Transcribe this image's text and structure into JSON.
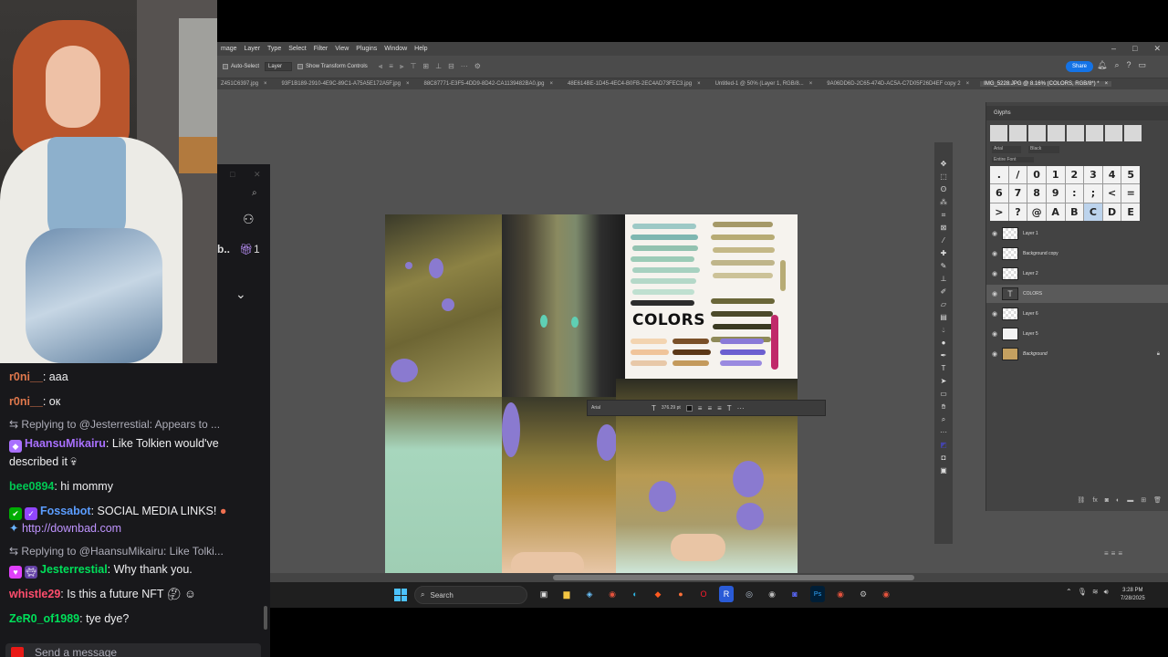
{
  "photoshop": {
    "menu": [
      "mage",
      "Layer",
      "Type",
      "Select",
      "Filter",
      "View",
      "Plugins",
      "Window",
      "Help"
    ],
    "options": {
      "auto_select_label": "Auto-Select",
      "auto_select_value": "Layer",
      "transform_label": "Show Transform Controls",
      "share_label": "Share"
    },
    "doc_tabs": [
      "Z451C6397.jpg",
      "93F1B189-2910-4E9C-89C1-A75A5E172A5F.jpg",
      "88C87771-E3F5-4DD9-8D42-CA1139482BA0.jpg",
      "48E614BE-1D45-4EC4-B0FB-2EC4AD73FEC3.jpg",
      "Untitled-1 @ 50% (Layer 1, RGB/8...",
      "9A06DD6D-2C65-474D-AC5A-C7D05F26D4EF copy 2",
      "IMG_5228.JPG @ 8.16% (COLORS, RGB/8*) *"
    ],
    "canvas_text": "COLORS",
    "text_bar": {
      "font": "Arial",
      "size": "376.29 pt"
    },
    "glyphs": {
      "title": "Glyphs",
      "font": "Arial",
      "style": "Black",
      "scope": "Entire Font",
      "chars": [
        ".",
        "/",
        "0",
        "1",
        "2",
        "3",
        "4",
        "5",
        "6",
        "7",
        "8",
        "9",
        ":",
        ";",
        "<",
        "=",
        ">",
        "?",
        "@",
        "A",
        "B",
        "C",
        "D",
        "E"
      ]
    },
    "layers": [
      "Layer 1",
      "Background copy",
      "Layer 2",
      "COLORS",
      "Layer 6",
      "Layer 5",
      "Background"
    ]
  },
  "taskbar": {
    "search_label": "Search",
    "time": "3:28 PM",
    "date": "7/28/2025"
  },
  "chat": {
    "messages": [
      {
        "user": "r0ni__",
        "color": "#e0784c",
        "text": ": aaa"
      },
      {
        "user": "r0ni__",
        "color": "#e0784c",
        "text": ": ок"
      },
      {
        "reply": "Replying to @Jesterrestial: Appears to ..."
      },
      {
        "user": "HaansuMikairu",
        "color": "#a970ff",
        "text": ": Like Tolkien would've described it"
      },
      {
        "user": "bee0894",
        "color": "#00c853",
        "text": ": hi mommy"
      },
      {
        "user": "Fossabot",
        "color": "#5b9dff",
        "text": ": SOCIAL MEDIA LINKS!"
      },
      {
        "link": "http://downbad.com"
      },
      {
        "reply": "Replying to @HaansuMikairu: Like Tolki..."
      },
      {
        "user": "Jesterrestial",
        "color": "#00e05a",
        "text": ": Why thank you."
      },
      {
        "user": "whistle29",
        "color": "#ff4d6d",
        "text": ": Is this a future NFT"
      },
      {
        "user": "ZeR0_of1989",
        "color": "#00e05a",
        "text": ": tye dye?"
      }
    ],
    "input_placeholder": "Send a message"
  },
  "left_panel": {
    "count": "1",
    "label_fragment": "b.."
  }
}
